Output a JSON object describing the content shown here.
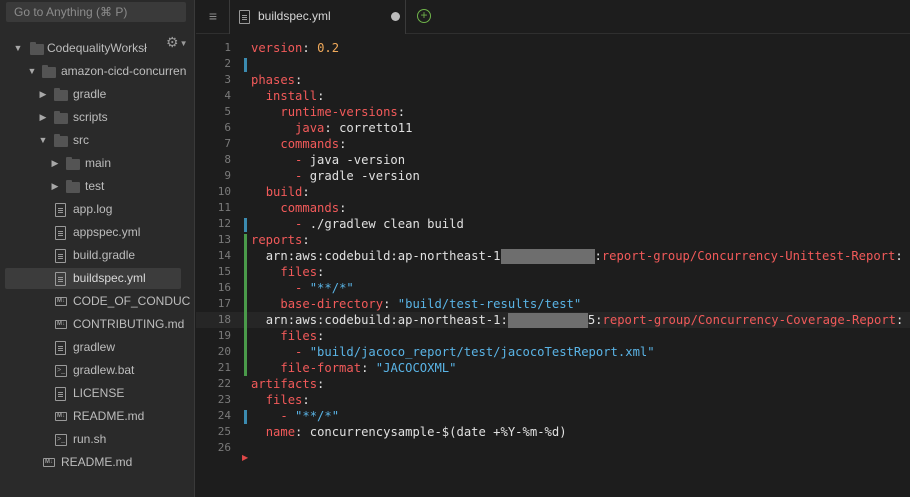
{
  "sidebar": {
    "search_placeholder": "Go to Anything (⌘ P)",
    "settings_icon": "gear-icon",
    "tree": [
      {
        "label": "CodequalityWorksł",
        "type": "folder",
        "expanded": true
      },
      {
        "label": "amazon-cicd-concurren",
        "type": "folder",
        "expanded": true
      },
      {
        "label": "gradle",
        "type": "folder",
        "expanded": false
      },
      {
        "label": "scripts",
        "type": "folder",
        "expanded": false
      },
      {
        "label": "src",
        "type": "folder",
        "expanded": true
      },
      {
        "label": "main",
        "type": "folder",
        "expanded": false
      },
      {
        "label": "test",
        "type": "folder",
        "expanded": false
      },
      {
        "label": "app.log",
        "type": "file"
      },
      {
        "label": "appspec.yml",
        "type": "file"
      },
      {
        "label": "build.gradle",
        "type": "file"
      },
      {
        "label": "buildspec.yml",
        "type": "file",
        "selected": true
      },
      {
        "label": "CODE_OF_CONDUC",
        "type": "markdown"
      },
      {
        "label": "CONTRIBUTING.md",
        "type": "markdown"
      },
      {
        "label": "gradlew",
        "type": "file"
      },
      {
        "label": "gradlew.bat",
        "type": "terminal"
      },
      {
        "label": "LICENSE",
        "type": "file"
      },
      {
        "label": "README.md",
        "type": "markdown"
      },
      {
        "label": "run.sh",
        "type": "terminal"
      },
      {
        "label": "README.md",
        "type": "markdown"
      }
    ]
  },
  "tabs": {
    "active_label": "buildspec.yml",
    "unsaved": true
  },
  "editor": {
    "line_numbers": [
      "1",
      "2",
      "3",
      "4",
      "5",
      "6",
      "7",
      "8",
      "9",
      "10",
      "11",
      "12",
      "13",
      "14",
      "15",
      "16",
      "17",
      "18",
      "19",
      "20",
      "21",
      "22",
      "23",
      "24",
      "25",
      "26"
    ],
    "tokens": {
      "l1_key": "version",
      "l1_val": "0.2",
      "l3_key": "phases",
      "l4_key": "install",
      "l5_key": "runtime-versions",
      "l6_key": "java",
      "l6_val": "corretto11",
      "l7_key": "commands",
      "l8_val": "java -version",
      "l9_val": "gradle -version",
      "l10_key": "build",
      "l11_key": "commands",
      "l12_val": "./gradlew clean build",
      "l13_key": "reports",
      "l14_pre": "arn:aws:codebuild:ap-northeast-1",
      "l14_post": "report-group/Concurrency-Unittest-Report",
      "l15_key": "files",
      "l16_val": "\"**/*\"",
      "l17_key": "base-directory",
      "l17_val": "\"build/test-results/test\"",
      "l18_pre": "arn:aws:codebuild:ap-northeast-1:",
      "l18_digit": "5",
      "l18_post": "report-group/Concurrency-Coverage-Report",
      "l19_key": "files",
      "l20_val": "\"build/jacoco_report/test/jacocoTestReport.xml\"",
      "l21_key": "file-format",
      "l21_val": "\"JACOCOXML\"",
      "l22_key": "artifacts",
      "l23_key": "files",
      "l24_val": "\"**/*\"",
      "l25_key": "name",
      "l25_val": "concurrencysample-$(date +%Y-%m-%d)"
    }
  },
  "colors": {
    "key": "#f25a5a",
    "string": "#5ab4e6",
    "number": "#f0a95a",
    "accent_add": "#6fb34a"
  }
}
